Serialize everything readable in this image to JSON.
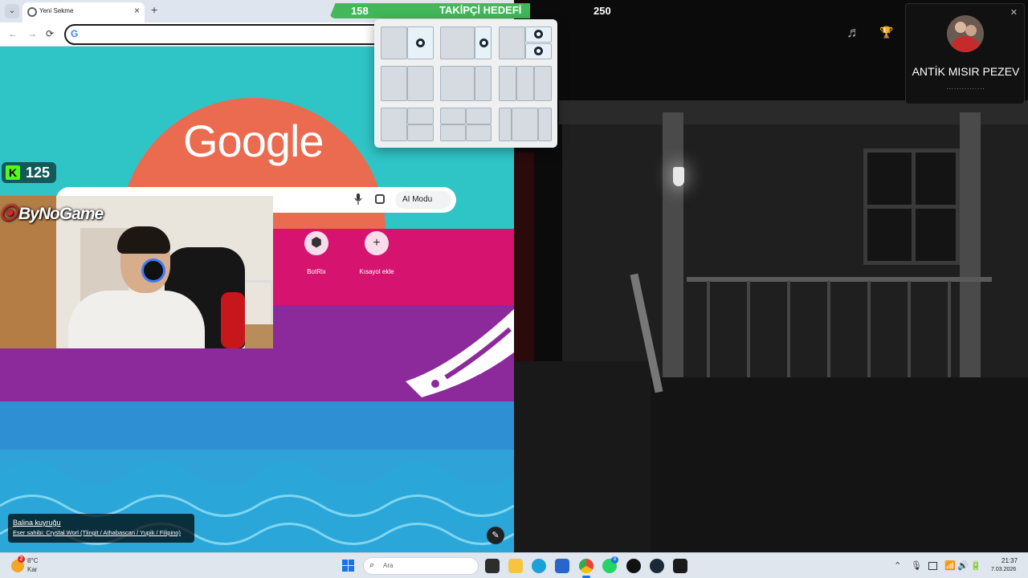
{
  "browser": {
    "tab_title": "Yeni Sekme",
    "tab_close": "×",
    "new_tab": "+",
    "tab_list": "⌄",
    "nav_back": "←",
    "nav_forward": "→",
    "nav_reload": "⟳",
    "omnibox_icon": "G",
    "omnibox_value": ""
  },
  "newtab": {
    "logo": "Google",
    "ai_mode_label": "AI Modu",
    "shortcuts": [
      {
        "label": "BotRix",
        "icon": "⬢"
      },
      {
        "label": "Kısayol ekle",
        "icon": "+"
      }
    ],
    "attribution": {
      "title": "Balina kuyruğu",
      "author": "Eser sahibi: Crystal Worl (Tlingit / Athabascan / Yupik / Filipino)"
    },
    "edit_icon": "✎"
  },
  "stream": {
    "kick_count": "125",
    "kick_logo": "K",
    "brand": "ByNoGame",
    "brand_logo": "⦿",
    "goal": {
      "current": "158",
      "title": "TAKİPÇİ HEDEFİ",
      "target": "250",
      "progress": 0.632
    },
    "hud_icons": [
      "music-icon",
      "trophy-icon"
    ],
    "hud_music": "♬",
    "hud_trophy": "🏆"
  },
  "notification": {
    "name": "ANTİK MISIR PEZEV",
    "subtitle": "...............",
    "close": "✕"
  },
  "taskbar": {
    "temperature": "8°C",
    "condition": "Kar",
    "weather_badge": "2",
    "search_placeholder": "Ara",
    "search_icon": "⌕",
    "whatsapp_badge": "8",
    "time": "21:37",
    "date": "7.03.2026",
    "tray": {
      "chevron": "⌃",
      "mic": "🎙",
      "wifi": "📶",
      "volume": "🔊",
      "battery": "🔋"
    }
  },
  "colors": {
    "goal_green": "#42b85a",
    "kick_green": "#53fc18",
    "sea_teal": "#2fc4c6",
    "sun_orange": "#ea6b4f",
    "magenta": "#d6146f",
    "purple": "#8c2a9b",
    "sea_blue": "#2f8fd3"
  }
}
